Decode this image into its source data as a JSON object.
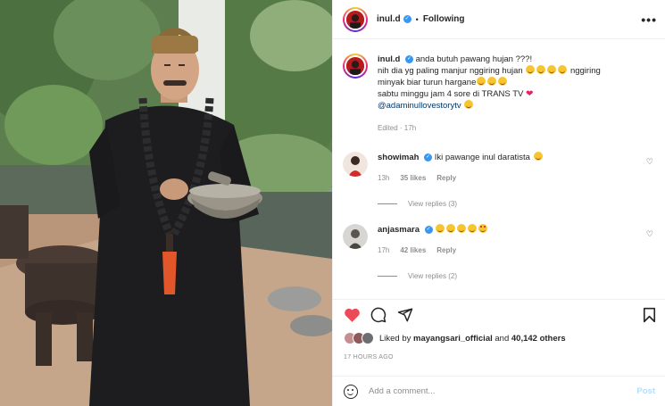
{
  "header": {
    "username": "inul.d",
    "separator": "•",
    "follow_status": "Following",
    "more_icon": "more-horizontal-icon"
  },
  "caption": {
    "username": "inul.d",
    "line1": "anda butuh pawang hujan ???!",
    "line2_a": "nih dia yg paling manjur nggiring hujan",
    "line2_b": "nggiring",
    "line3_a": "minyak biar turun hargane",
    "line4": "sabtu minggu jam 4 sore di TRANS TV",
    "mention": "@adaminullovestorytv",
    "time": "Edited · 17h"
  },
  "comments": [
    {
      "username": "showimah",
      "text": "Iki pawange inul daratista",
      "time": "13h",
      "likes": "35 likes",
      "reply": "Reply",
      "view_replies": "View replies (3)"
    },
    {
      "username": "anjasmara",
      "text": "",
      "time": "17h",
      "likes": "42 likes",
      "reply": "Reply",
      "view_replies": "View replies (2)"
    }
  ],
  "likes": {
    "prefix": "Liked by",
    "first": "mayangsari_official",
    "and": "and",
    "others": "40,142 others"
  },
  "timestamp": "17 HOURS AGO",
  "add_comment": {
    "placeholder": "Add a comment...",
    "post_label": "Post"
  },
  "colors": {
    "heart_liked": "#ed4956",
    "verified": "#3897f0",
    "post_disabled": "#b2dffc",
    "mention": "#00376b"
  },
  "icons": [
    "heart-icon",
    "comment-icon",
    "share-icon",
    "bookmark-icon",
    "emoji-icon",
    "verified-badge-icon"
  ]
}
